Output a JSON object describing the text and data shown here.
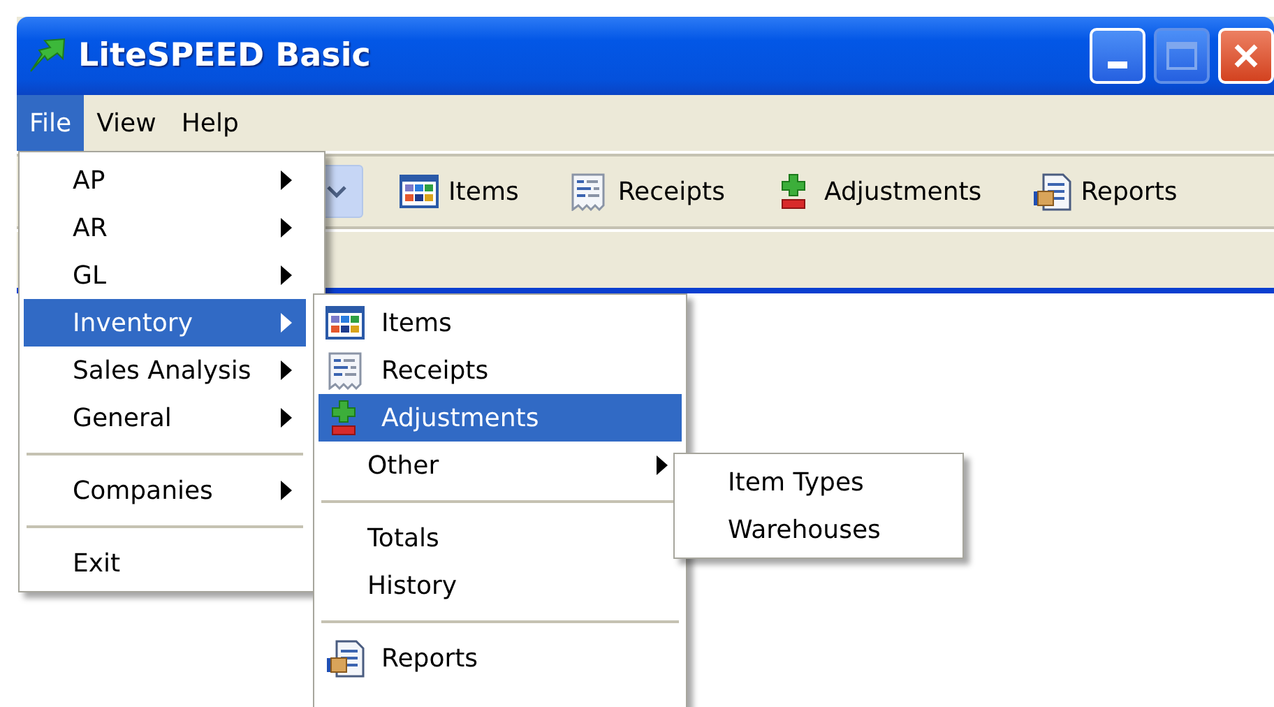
{
  "window": {
    "title": "LiteSPEED Basic"
  },
  "menu_bar": [
    {
      "label": "File",
      "selected": true
    },
    {
      "label": "View",
      "selected": false
    },
    {
      "label": "Help",
      "selected": false
    }
  ],
  "toolbar": [
    {
      "kind": "grid",
      "label": "Items"
    },
    {
      "kind": "receipt",
      "label": "Receipts"
    },
    {
      "kind": "adjust",
      "label": "Adjustments"
    },
    {
      "kind": "report",
      "label": "Reports"
    }
  ],
  "file_menu": [
    {
      "kind": "text",
      "label": "AP",
      "submenu": true,
      "selected": false
    },
    {
      "kind": "text",
      "label": "AR",
      "submenu": true,
      "selected": false
    },
    {
      "kind": "text",
      "label": "GL",
      "submenu": true,
      "selected": false
    },
    {
      "kind": "text",
      "label": "Inventory",
      "submenu": true,
      "selected": true
    },
    {
      "kind": "text",
      "label": "Sales Analysis",
      "submenu": true,
      "selected": false
    },
    {
      "kind": "text",
      "label": "General",
      "submenu": true,
      "selected": false
    },
    {
      "kind": "separator"
    },
    {
      "kind": "text",
      "label": "Companies",
      "submenu": true,
      "selected": false
    },
    {
      "kind": "separator"
    },
    {
      "kind": "text",
      "label": "Exit",
      "submenu": false,
      "selected": false
    }
  ],
  "inventory_menu": [
    {
      "kind": "grid",
      "label": "Items",
      "submenu": false,
      "selected": false
    },
    {
      "kind": "receipt",
      "label": "Receipts",
      "submenu": false,
      "selected": false
    },
    {
      "kind": "adjust",
      "label": "Adjustments",
      "submenu": false,
      "selected": true
    },
    {
      "kind": "text",
      "label": "Other",
      "submenu": true,
      "selected": false
    },
    {
      "kind": "separator"
    },
    {
      "kind": "text",
      "label": "Totals",
      "submenu": false,
      "selected": false
    },
    {
      "kind": "text",
      "label": "History",
      "submenu": false,
      "selected": false
    },
    {
      "kind": "separator"
    },
    {
      "kind": "report",
      "label": "Reports",
      "submenu": false,
      "selected": false
    }
  ],
  "other_menu": [
    {
      "kind": "text",
      "label": "Item Types",
      "submenu": false,
      "selected": false
    },
    {
      "kind": "text",
      "label": "Warehouses",
      "submenu": false,
      "selected": false
    }
  ]
}
